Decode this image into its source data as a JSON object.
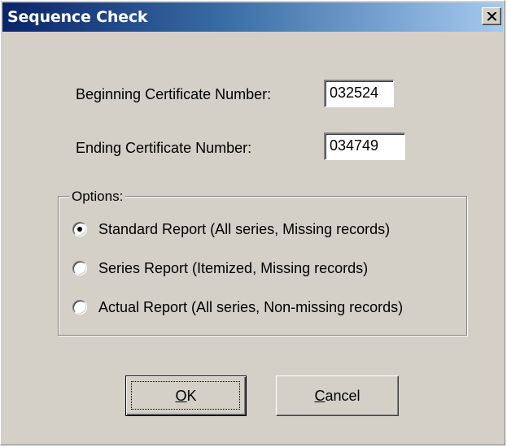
{
  "window": {
    "title": "Sequence Check",
    "close_icon": "close-x-icon"
  },
  "fields": {
    "beginning_label": "Beginning Certificate Number:",
    "beginning_value": "032524",
    "ending_label": "Ending Certificate Number:",
    "ending_value": "034749"
  },
  "options": {
    "legend": "Options:",
    "selected": "standard",
    "items": [
      {
        "id": "standard",
        "label": "Standard Report (All series, Missing records)",
        "checked": true
      },
      {
        "id": "series",
        "label": "Series Report (Itemized, Missing records)",
        "checked": false
      },
      {
        "id": "actual",
        "label": "Actual Report (All series, Non-missing records)",
        "checked": false
      }
    ]
  },
  "buttons": {
    "ok_mnemonic": "O",
    "ok_rest": "K",
    "cancel_mnemonic": "C",
    "cancel_rest": "ancel"
  },
  "colors": {
    "dialog_face": "#d4d0c8",
    "titlebar_start": "#0a246a",
    "titlebar_end": "#a6caf0"
  }
}
